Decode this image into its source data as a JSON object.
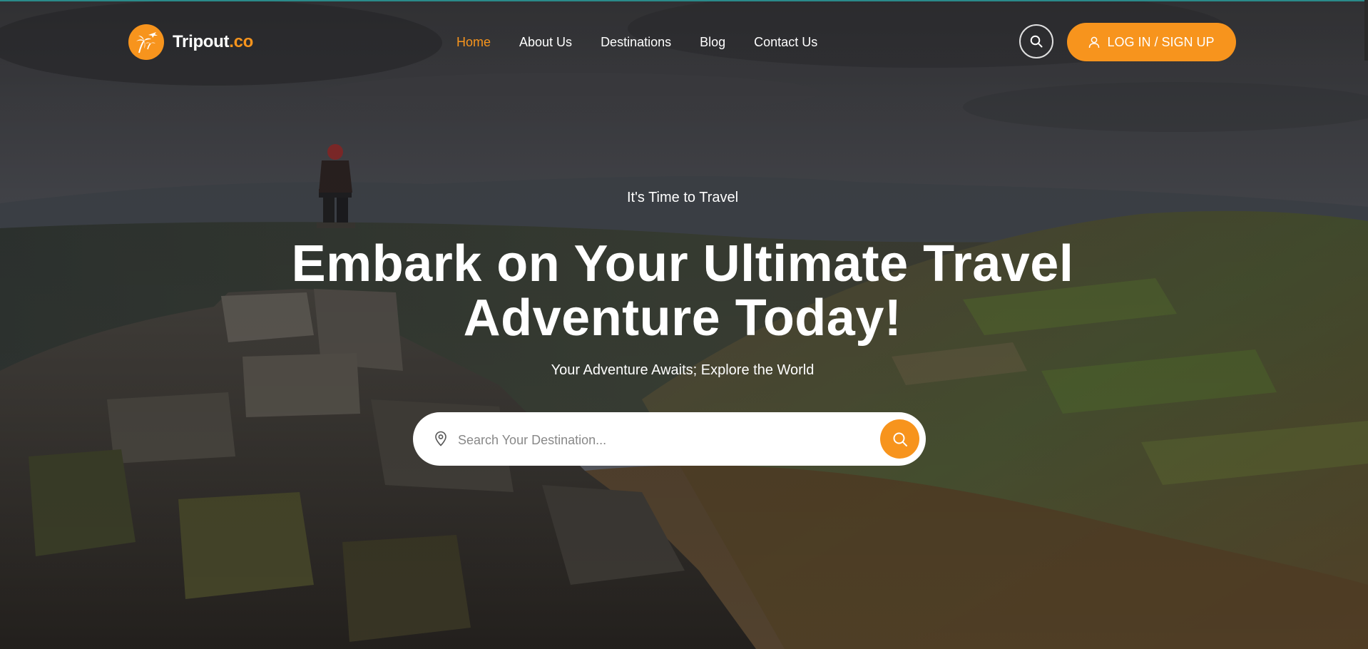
{
  "brand": {
    "name_main": "Tripout",
    "name_suffix": ".co",
    "accent_color": "#f7941d"
  },
  "nav": {
    "items": [
      {
        "label": "Home",
        "active": true
      },
      {
        "label": "About Us",
        "active": false
      },
      {
        "label": "Destinations",
        "active": false
      },
      {
        "label": "Blog",
        "active": false
      },
      {
        "label": "Contact Us",
        "active": false
      }
    ]
  },
  "header": {
    "search_icon": "search-icon",
    "login_label": "LOG IN / SIGN UP",
    "login_icon": "user-icon"
  },
  "hero": {
    "eyebrow": "It's Time to Travel",
    "headline_line1": "Embark on Your Ultimate Travel",
    "headline_line2": "Adventure Today!",
    "subheadline": "Your Adventure Awaits; Explore the World",
    "search": {
      "placeholder": "Search Your Destination...",
      "value": "",
      "pin_icon": "map-pin-icon",
      "submit_icon": "search-icon"
    }
  }
}
